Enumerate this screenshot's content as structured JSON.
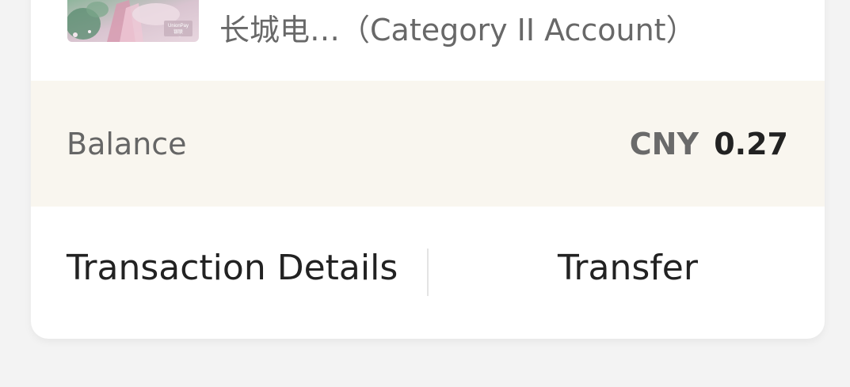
{
  "account": {
    "name": "长城电…（Category II Account）",
    "card_icon": "unionpay-card-thumbnail",
    "card_brand": "UnionPay"
  },
  "balance": {
    "label": "Balance",
    "currency": "CNY",
    "amount": "0.27"
  },
  "actions": {
    "details_label": "Transaction Details",
    "transfer_label": "Transfer"
  },
  "colors": {
    "page_bg": "#f3f3f3",
    "card_bg": "#ffffff",
    "balance_bg": "#f9f6ef",
    "primary_text": "#222222",
    "secondary_text": "#686868"
  }
}
